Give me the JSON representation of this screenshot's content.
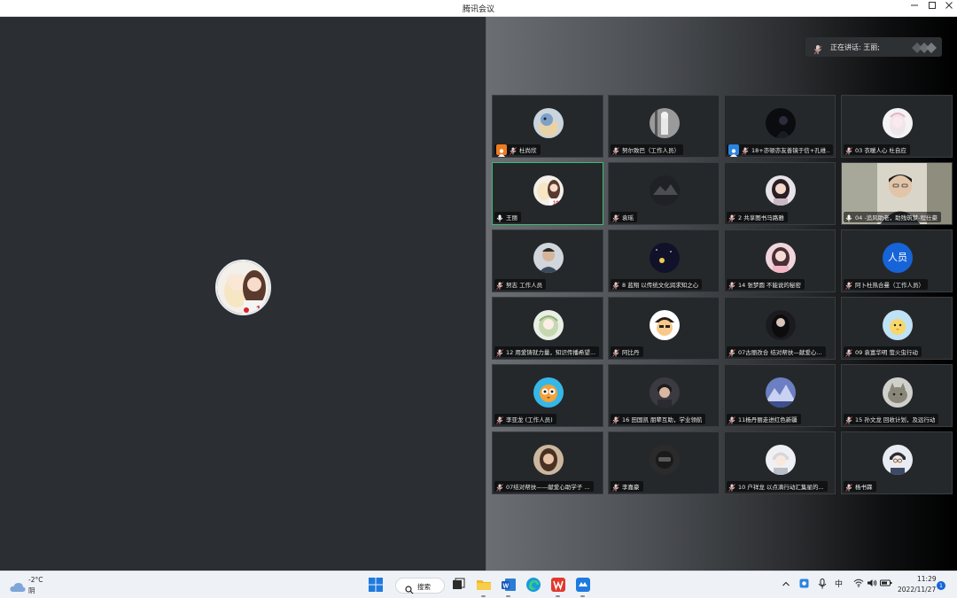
{
  "window": {
    "title": "腾讯会议"
  },
  "speaking": {
    "text": "正在讲话: 王丽;"
  },
  "participants": [
    {
      "name": "杜尚欣",
      "avatar": "cartoon-bird",
      "badge": "host"
    },
    {
      "name": "努尔致巴（工作人员）",
      "avatar": "statue"
    },
    {
      "name": "18+亦顿亦友善镜于信+孔维...",
      "avatar": "dark-figure",
      "badge": "cohost"
    },
    {
      "name": "03 衣暖人心 杜自应",
      "avatar": "anime-girl-white"
    },
    {
      "name": "王丽",
      "avatar": "anime-couple",
      "active": true
    },
    {
      "name": "袁瑶",
      "avatar": "dark-scene"
    },
    {
      "name": "2 共享图书马路雅",
      "avatar": "girl-portrait"
    },
    {
      "name": "04 -追风助老，助残筑梦-程仕豪",
      "avatar": "video"
    },
    {
      "name": "努志 工作人员",
      "avatar": "man-portrait"
    },
    {
      "name": "8 蓝翔 以传统文化润求知之心",
      "avatar": "night-sky"
    },
    {
      "name": "14 张梦圆 不能说的秘密",
      "avatar": "pink-girl"
    },
    {
      "name": "阿卜杜热合曼（工作人员）",
      "avatar": "text-avatar",
      "avatar_text": "人员"
    },
    {
      "name": "12 用爱铸就力量，知识传播希望...",
      "avatar": "anime-green"
    },
    {
      "name": "阿比丹",
      "avatar": "cartoon-face"
    },
    {
      "name": "07古丽孜合 结对帮扶—献爱心...",
      "avatar": "dark-girl"
    },
    {
      "name": "09 袁富华明 萤火虫行动",
      "avatar": "cartoon-chick"
    },
    {
      "name": "李亚龙 (工作人员)",
      "avatar": "cartoon-owl"
    },
    {
      "name": "16 田国凯 朋辈互助，学业领航",
      "avatar": "boy-portrait"
    },
    {
      "name": "11杨丹丽走进红色新疆",
      "avatar": "mountain"
    },
    {
      "name": "15 孙文龙 回收计划，及远行动",
      "avatar": "cat"
    },
    {
      "name": "07结对帮扶——献爱心助学子 ...",
      "avatar": "woman-portrait"
    },
    {
      "name": "李嘉豪",
      "avatar": "helmet"
    },
    {
      "name": "10 户祥龙 以点滴行动汇集星的...",
      "avatar": "anime-boy"
    },
    {
      "name": "杨书霖",
      "avatar": "anime-boy-glasses"
    }
  ],
  "taskbar": {
    "weather": {
      "temp": "-2°C",
      "condition": "阴",
      "icon": "cloud-icon"
    },
    "search_label": "搜索",
    "tray_lang": "中",
    "time": "11:29",
    "date": "2022/11/27",
    "notifications": "1"
  },
  "colors": {
    "accent": "#1664d8",
    "active_tile_border": "#3fb97a",
    "stage_bg": "#2b2e32"
  }
}
